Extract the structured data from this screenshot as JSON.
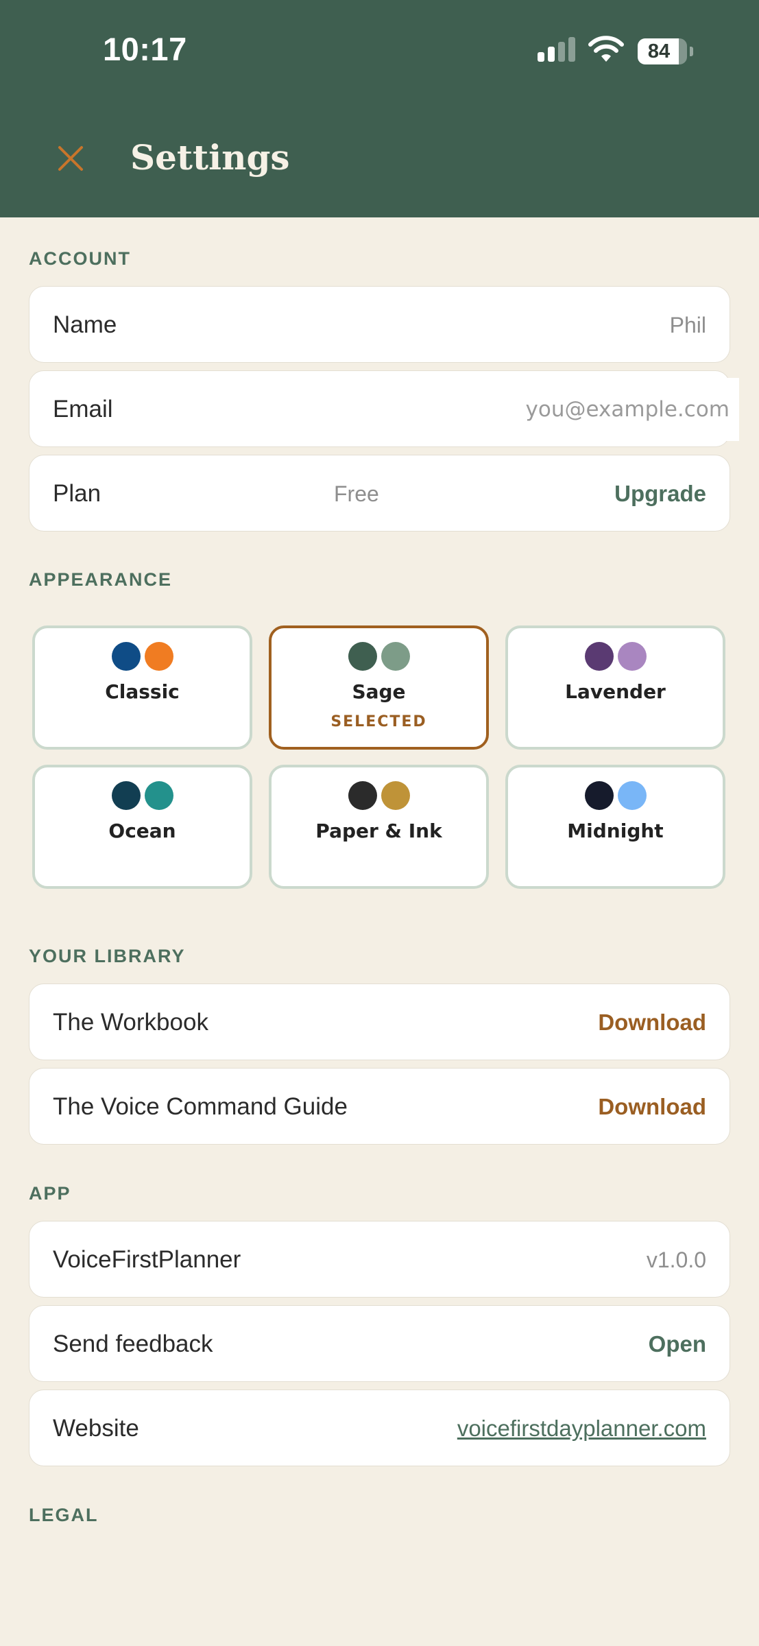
{
  "status_bar": {
    "time": "10:17",
    "battery": "84",
    "battery_level": 0.84,
    "icons": [
      "cellular-signal-icon",
      "wifi-icon",
      "battery-icon"
    ]
  },
  "header": {
    "title": "Settings",
    "close_icon": "close-icon",
    "background_color": "#3f5f50",
    "accent_color": "#c8752b"
  },
  "account": {
    "section_title": "ACCOUNT",
    "name_label": "Name",
    "name_value": "Phil",
    "email_label": "Email",
    "email_placeholder": "you@example.com",
    "plan_label": "Plan",
    "plan_value": "Free",
    "plan_action": "Upgrade"
  },
  "appearance": {
    "section_title": "APPEARANCE",
    "selected_label": "SELECTED",
    "themes": [
      {
        "name": "Classic",
        "colors": [
          "#0f4c86",
          "#f07c22"
        ],
        "selected": false
      },
      {
        "name": "Sage",
        "colors": [
          "#3f5f50",
          "#7d9c88"
        ],
        "selected": true
      },
      {
        "name": "Lavender",
        "colors": [
          "#5a3a72",
          "#a986c0"
        ],
        "selected": false
      },
      {
        "name": "Ocean",
        "colors": [
          "#123e52",
          "#23918c"
        ],
        "selected": false
      },
      {
        "name": "Paper & Ink",
        "colors": [
          "#2b2b2b",
          "#bf9338"
        ],
        "selected": false
      },
      {
        "name": "Midnight",
        "colors": [
          "#161b2c",
          "#79b6f7"
        ],
        "selected": false
      }
    ]
  },
  "library": {
    "section_title": "YOUR LIBRARY",
    "items": [
      {
        "label": "The Workbook",
        "action": "Download"
      },
      {
        "label": "The Voice Command Guide",
        "action": "Download"
      }
    ]
  },
  "app": {
    "section_title": "APP",
    "app_name": "VoiceFirstPlanner",
    "version": "v1.0.0",
    "feedback_label": "Send feedback",
    "feedback_action": "Open",
    "website_label": "Website",
    "website_link": "voicefirstdayplanner.com"
  },
  "legal": {
    "section_title": "LEGAL"
  }
}
